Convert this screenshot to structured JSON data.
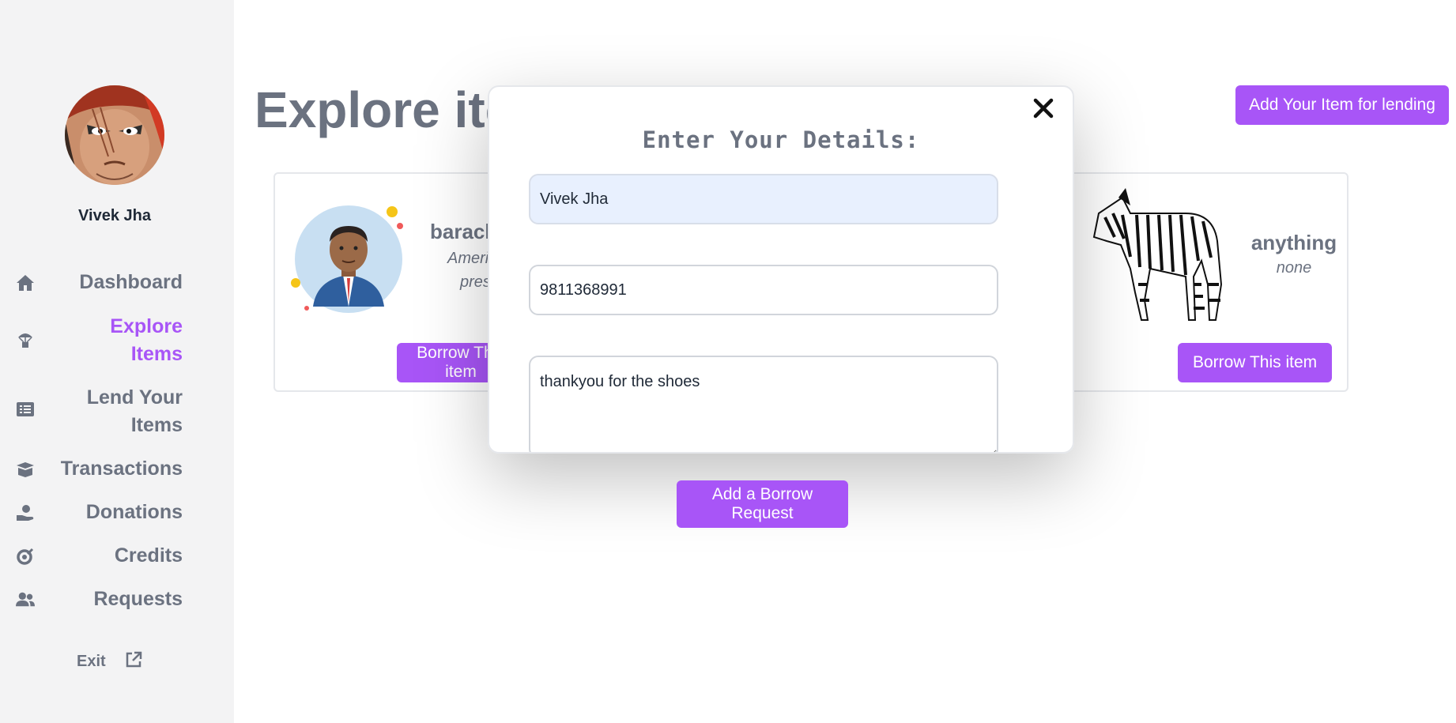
{
  "user": {
    "name": "Vivek Jha"
  },
  "sidebar": {
    "items": [
      {
        "label_lines": [
          "Dashboard"
        ],
        "icon": "home-icon"
      },
      {
        "label_lines": [
          "Explore",
          "Items"
        ],
        "icon": "parachute-box-icon",
        "active": true
      },
      {
        "label_lines": [
          "Lend Your",
          "Items"
        ],
        "icon": "list-alt-icon"
      },
      {
        "label_lines": [
          "Transactions"
        ],
        "icon": "box-open-icon"
      },
      {
        "label_lines": [
          "Donations"
        ],
        "icon": "hand-holding-icon"
      },
      {
        "label_lines": [
          "Credits"
        ],
        "icon": "coin-icon"
      },
      {
        "label_lines": [
          "Requests"
        ],
        "icon": "users-icon"
      }
    ],
    "exit_label": "Exit"
  },
  "main": {
    "page_title": "Explore items",
    "add_item_button": "Add Your Item for lending",
    "cards": [
      {
        "title": "barack",
        "desc_lines": [
          "Ameri",
          "pres"
        ],
        "button": "Borrow This item"
      },
      {
        "title": "anything",
        "desc": "none",
        "button": "Borrow This item"
      }
    ]
  },
  "modal": {
    "title": "Enter Your Details:",
    "name_value": "Vivek Jha",
    "phone_value": "9811368991",
    "message_value": "thankyou for the shoes",
    "submit_label": "Add a Borrow Request"
  },
  "colors": {
    "accent": "#a855f7",
    "muted_text": "#6b7280",
    "sidebar_bg": "#f3f3f4",
    "autofill_bg": "#e8f0fe"
  }
}
